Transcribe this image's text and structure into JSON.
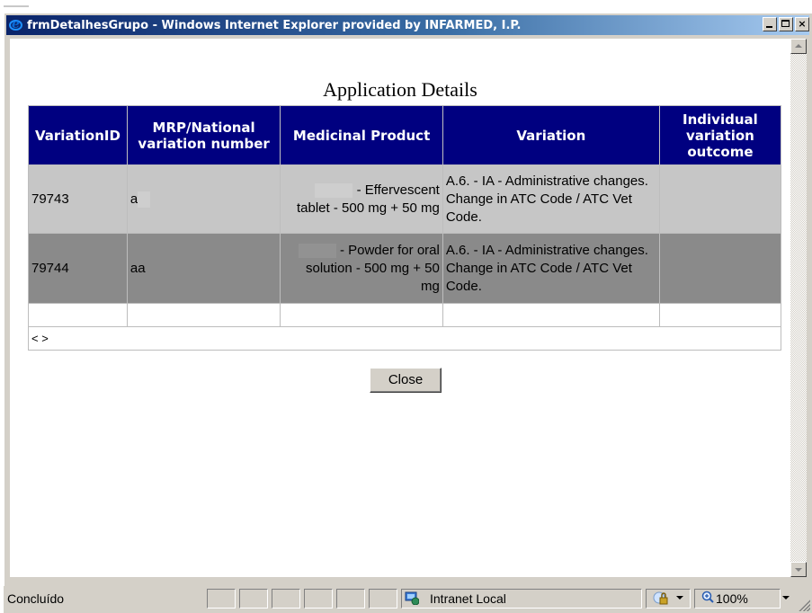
{
  "window": {
    "title": "frmDetalhesGrupo - Windows Internet Explorer provided by INFARMED, I.P.",
    "minimize": "_",
    "maximize": "□",
    "close": "×"
  },
  "page": {
    "title": "Application Details",
    "close_label": "Close"
  },
  "table": {
    "headers": [
      "VariationID",
      "MRP/National variation number",
      "Medicinal Product",
      "Variation",
      "Individual variation outcome"
    ],
    "rows": [
      {
        "id": "79743",
        "mrp": "a",
        "product": "- Effervescent tablet - 500 mg + 50 mg",
        "variation": "A.6. - IA - Administrative changes. Change in ATC Code / ATC Vet Code.",
        "outcome": ""
      },
      {
        "id": "79744",
        "mrp": "aa",
        "product": "- Powder for oral solution - 500 mg + 50 mg",
        "variation": "A.6. - IA - Administrative changes. Change in ATC Code / ATC Vet Code.",
        "outcome": ""
      }
    ],
    "pager": "< >"
  },
  "status": {
    "text": "Concluído",
    "zone": "Intranet Local",
    "zoom": "100%"
  },
  "icons": {
    "browser": "ie-icon",
    "zone": "intranet-zone-icon",
    "protected_mode": "lock-icon",
    "zoom": "zoom-icon"
  },
  "colors": {
    "title_bar": "#0a246a",
    "header_bg": "#000080",
    "row1_bg": "#c6c6c6",
    "row2_bg": "#8a8a8a"
  }
}
